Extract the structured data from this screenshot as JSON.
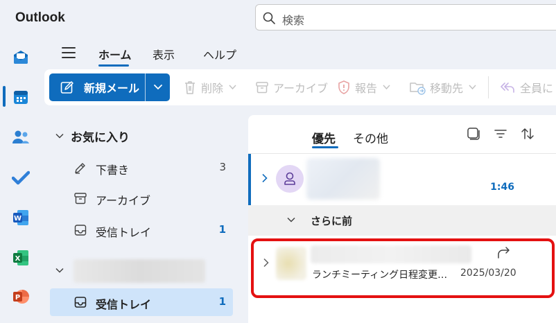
{
  "app": {
    "title": "Outlook"
  },
  "search": {
    "placeholder": "検索"
  },
  "rail": {
    "items": [
      "mail-icon",
      "calendar-icon",
      "people-icon",
      "todo-icon",
      "word-icon",
      "excel-icon",
      "powerpoint-icon"
    ],
    "active": "mail-icon"
  },
  "ribbon": {
    "tabs": [
      {
        "label": "ホーム",
        "active": true
      },
      {
        "label": "表示",
        "active": false
      },
      {
        "label": "ヘルプ",
        "active": false
      }
    ],
    "toolbar": {
      "new_mail": "新規メール",
      "delete": "削除",
      "archive": "アーカイブ",
      "report": "報告",
      "move": "移動先",
      "reply_all": "全員に"
    }
  },
  "folders": {
    "favorites_label": "お気に入り",
    "items": [
      {
        "name": "下書き",
        "count": "3",
        "icon": "draft-icon"
      },
      {
        "name": "アーカイブ",
        "count": "",
        "icon": "archive-icon"
      },
      {
        "name": "受信トレイ",
        "count": "1",
        "icon": "inbox-icon"
      }
    ],
    "account_inbox": {
      "name": "受信トレイ",
      "count": "1",
      "icon": "inbox-icon"
    }
  },
  "message_list": {
    "pivots": [
      {
        "label": "優先",
        "active": true
      },
      {
        "label": "その他",
        "active": false
      }
    ],
    "messages": [
      {
        "time": "1:46",
        "unread": true
      },
      {
        "subject": "ランチミーティング日程変更…",
        "date": "2025/03/20"
      }
    ],
    "group_label": "さらに前"
  },
  "colors": {
    "accent": "#0f6cbd",
    "highlight_outline": "#e41111",
    "selected_bg": "#cfe4fa"
  }
}
